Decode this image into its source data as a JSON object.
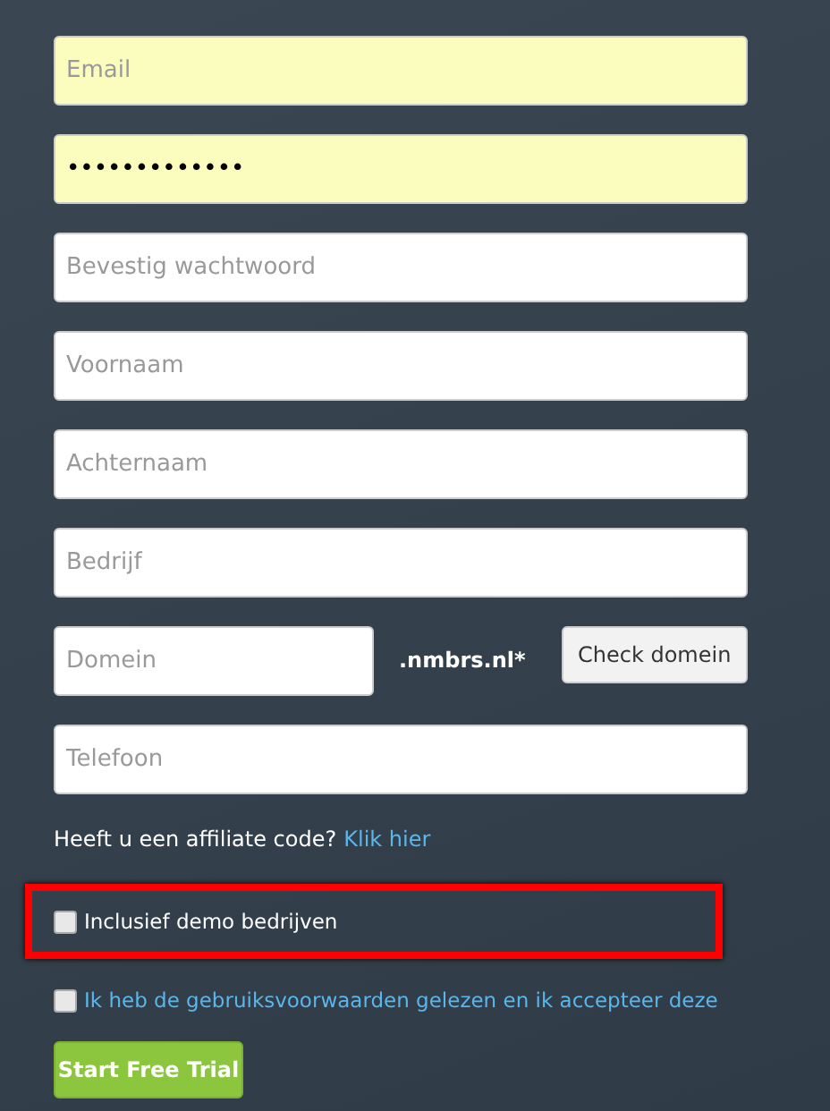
{
  "fields": [
    {
      "placeholder": "Email",
      "autofilled": true
    },
    {
      "value": "•••••••••••••",
      "autofilled": true
    },
    {
      "placeholder": "Bevestig wachtwoord",
      "autofilled": false
    },
    {
      "placeholder": "Voornaam",
      "autofilled": false
    },
    {
      "placeholder": "Achternaam",
      "autofilled": false
    },
    {
      "placeholder": "Bedrijf",
      "autofilled": false
    }
  ],
  "domain": {
    "placeholder": "Domein",
    "suffix": ".nmbrs.nl*",
    "button": "Check domein"
  },
  "phone": {
    "placeholder": "Telefoon"
  },
  "affiliate": {
    "text": "Heeft u een affiliate code?",
    "link": "Klik hier"
  },
  "checkboxes": [
    {
      "label": "Inclusief demo bedrijven",
      "checked": false,
      "highlighted": true,
      "link": false
    },
    {
      "label": "Ik heb de gebruiksvoorwaarden gelezen en ik accepteer deze",
      "checked": false,
      "highlighted": false,
      "link": true
    }
  ],
  "submit": "Start Free Trial"
}
